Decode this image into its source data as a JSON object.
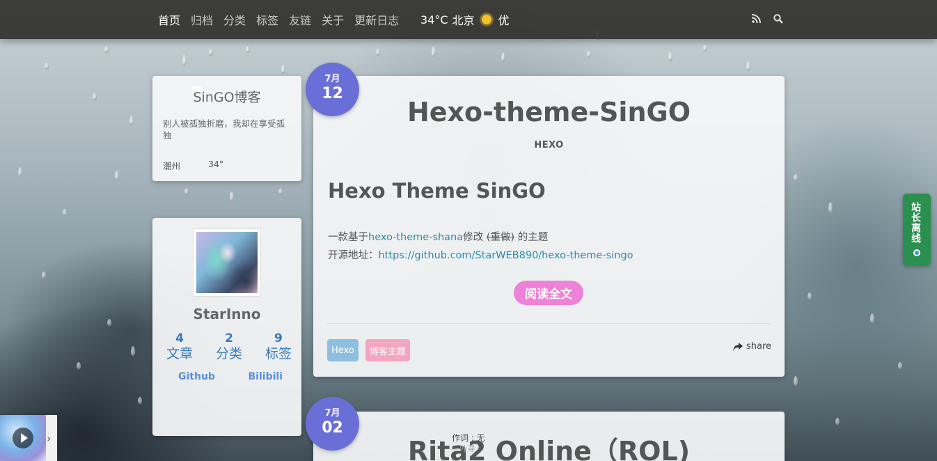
{
  "nav": {
    "items": [
      "首页",
      "归档",
      "分类",
      "标签",
      "友链",
      "关于",
      "更新日志"
    ],
    "weather": {
      "temp": "34°C",
      "city": "北京",
      "quality": "优"
    }
  },
  "blog": {
    "title": "SinGO博客",
    "desc": "别人被孤独折磨，我却在享受孤独",
    "city": "潮州",
    "temp": "34°"
  },
  "author": {
    "name": "StarInno",
    "stats": [
      {
        "n": "4",
        "l": "文章"
      },
      {
        "n": "2",
        "l": "分类"
      },
      {
        "n": "9",
        "l": "标签"
      }
    ],
    "links": [
      "Github",
      "Bilibili"
    ]
  },
  "post1": {
    "month": "7月",
    "day": "12",
    "title": "Hexo-theme-SinGO",
    "category": "HEXO",
    "heading": "Hexo Theme SinGO",
    "line1_pre": "一款基于",
    "line1_link": "hexo-theme-shana",
    "line1_mid": "修改 ",
    "line1_del": "(重做)",
    "line1_post": " 的主题",
    "line2_pre": "开源地址：",
    "line2_link": "https://github.com/StarWEB890/hexo-theme-singo",
    "read_more": "阅读全文",
    "tags": [
      {
        "label": "Hexo",
        "color": "#8fbfe0"
      },
      {
        "label": "博客主题",
        "color": "#f3a6c0"
      }
    ],
    "share": "share"
  },
  "post2": {
    "month": "7月",
    "day": "02",
    "title": "Rita2 Online（ROL)"
  },
  "player": {
    "lyric": "作词 : 无",
    "lyric_sub": "-- 叶寻"
  },
  "offline": {
    "label": "站长离线"
  }
}
